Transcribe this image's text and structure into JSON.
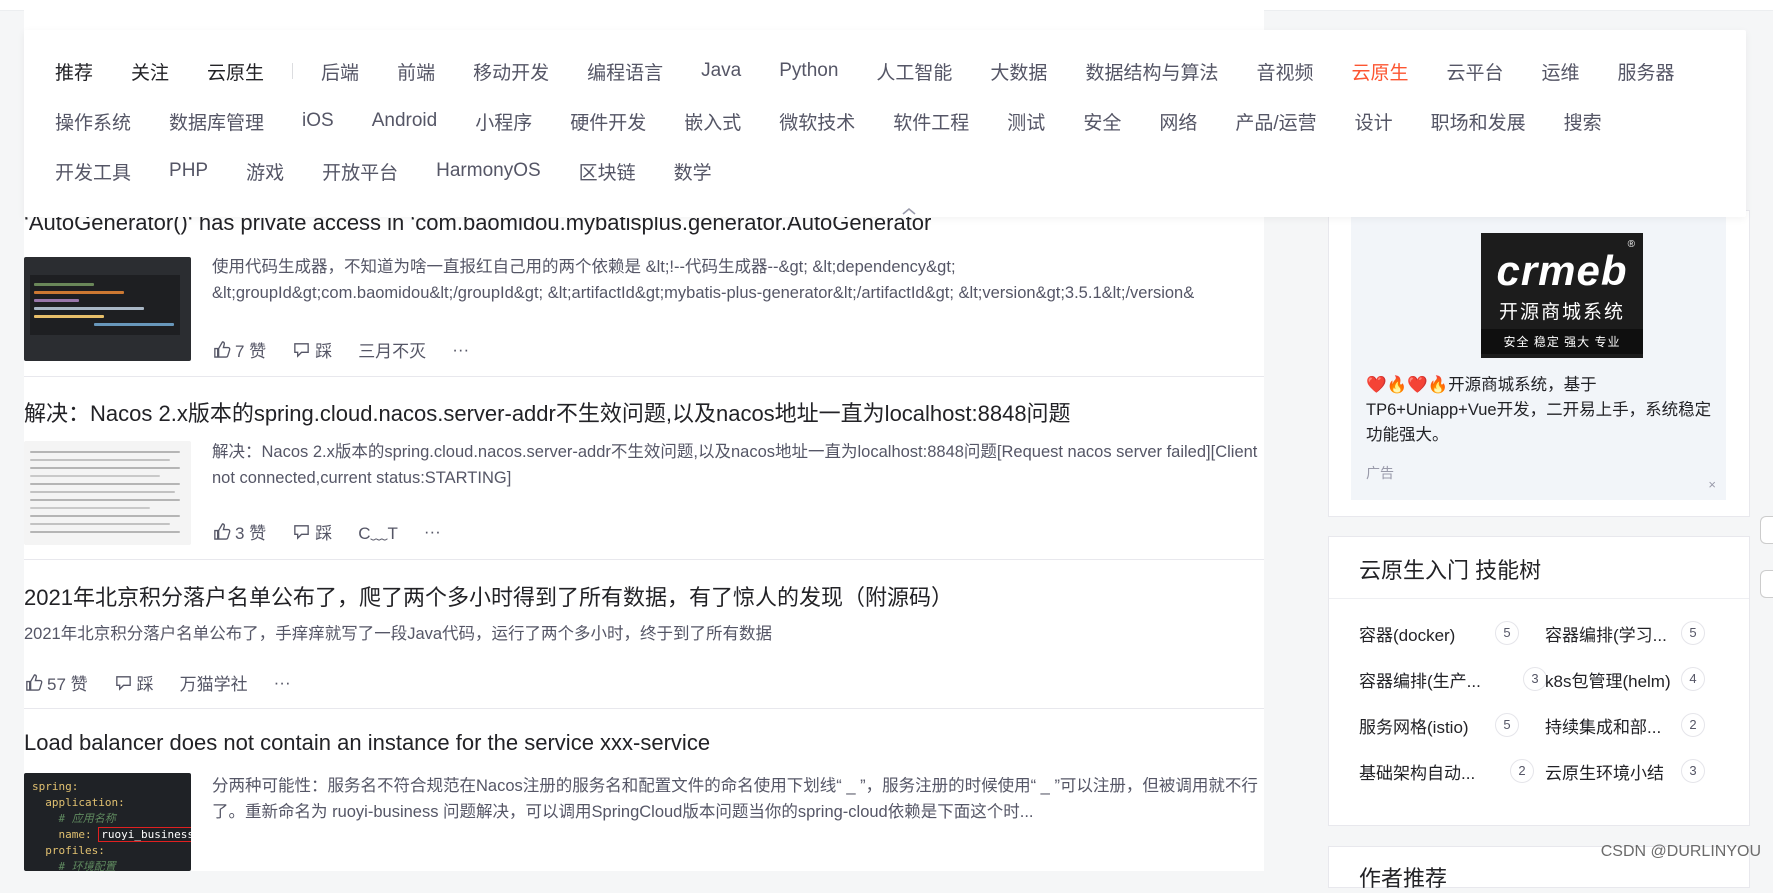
{
  "categories": {
    "fixed": [
      "推荐",
      "关注",
      "云原生"
    ],
    "row1": [
      "后端",
      "前端",
      "移动开发",
      "编程语言",
      "Java",
      "Python",
      "人工智能",
      "大数据",
      "数据结构与算法",
      "音视频",
      "云原生",
      "云平台",
      "运维",
      "服务器"
    ],
    "row2": [
      "操作系统",
      "数据库管理",
      "iOS",
      "Android",
      "小程序",
      "硬件开发",
      "嵌入式",
      "微软技术",
      "软件工程",
      "测试",
      "安全",
      "网络",
      "产品/运营",
      "设计",
      "职场和发展",
      "搜索"
    ],
    "row3": [
      "开发工具",
      "PHP",
      "游戏",
      "开放平台",
      "HarmonyOS",
      "区块链",
      "数学"
    ],
    "active": "云原生",
    "collapse_icon": "chevron-up-icon"
  },
  "articles": [
    {
      "title": "‘AutoGenerator()‘ has private access in ‘com.baomidou.mybatisplus.generator.AutoGenerator",
      "excerpt": "使用代码生成器，不知道为啥一直报红自己用的两个依赖是 &lt;!--代码生成器--&gt; &lt;dependency&gt; &lt;groupId&gt;com.baomidou&lt;/groupId&gt; &lt;artifactId&gt;mybatis-plus-generator&lt;/artifactId&gt; &lt;version&gt;3.5.1&lt;/version&",
      "likes": "7 赞",
      "dislike": "踩",
      "author": "三月不灭",
      "more": "···"
    },
    {
      "title": "解决：Nacos 2.x版本的spring.cloud.nacos.server-addr不生效问题,以及nacos地址一直为localhost:8848问题",
      "excerpt": "解决：Nacos 2.x版本的spring.cloud.nacos.server-addr不生效问题,以及nacos地址一直为localhost:8848问题[Request nacos server failed][Client not connected,current status:STARTING]",
      "likes": "3 赞",
      "dislike": "踩",
      "author": "C﹏T",
      "more": "···"
    },
    {
      "title": "2021年北京积分落户名单公布了，爬了两个多小时得到了所有数据，有了惊人的发现（附源码）",
      "excerpt": "2021年北京积分落户名单公布了，手痒痒就写了一段Java代码，运行了两个多小时，终于到了所有数据",
      "likes": "57 赞",
      "dislike": "踩",
      "author": "万猫学社",
      "more": "···"
    },
    {
      "title": "Load balancer does not contain an instance for the service xxx-service",
      "excerpt": "分两种可能性：服务名不符合规范在Nacos注册的服务名和配置文件的命名使用下划线“ _ ”，服务注册的时候使用“ _ ”可以注册，但被调用就不行了。重新命名为 ruoyi-business 问题解决，可以调用SpringCloud版本问题当你的spring-cloud依赖是下面这个时...",
      "thumb_code": [
        "spring:",
        "application:",
        "# 应用名称",
        "name:",
        "ruoyi_business",
        "profiles:",
        "# 环境配置"
      ]
    }
  ],
  "ad": {
    "brand": "crmeb",
    "brand_sub": "开源商城系统",
    "brand_tags": "安全 稳定 强大 专业",
    "registered": "®",
    "text": "❤️🔥❤️🔥开源商城系统，基于TP6+Uniapp+Vue开发，二开易上手，系统稳定 功能强大。",
    "label": "广告",
    "close": "×"
  },
  "skill_tree": {
    "title": "云原生入门 技能树",
    "items": [
      {
        "name": "容器(docker)",
        "count": "5"
      },
      {
        "name": "容器编排(学习...",
        "count": "5"
      },
      {
        "name": "容器编排(生产...",
        "count": "3"
      },
      {
        "name": "k8s包管理(helm)",
        "count": "4"
      },
      {
        "name": "服务网格(istio)",
        "count": "5"
      },
      {
        "name": "持续集成和部...",
        "count": "2"
      },
      {
        "name": "基础架构自动...",
        "count": "2"
      },
      {
        "name": "云原生环境小结",
        "count": "3"
      }
    ]
  },
  "author_recommend": {
    "title": "作者推荐"
  },
  "watermark": "CSDN @DURLINYOU",
  "colors": {
    "accent": "#fc5531",
    "text": "#222226",
    "muted": "#555666"
  }
}
